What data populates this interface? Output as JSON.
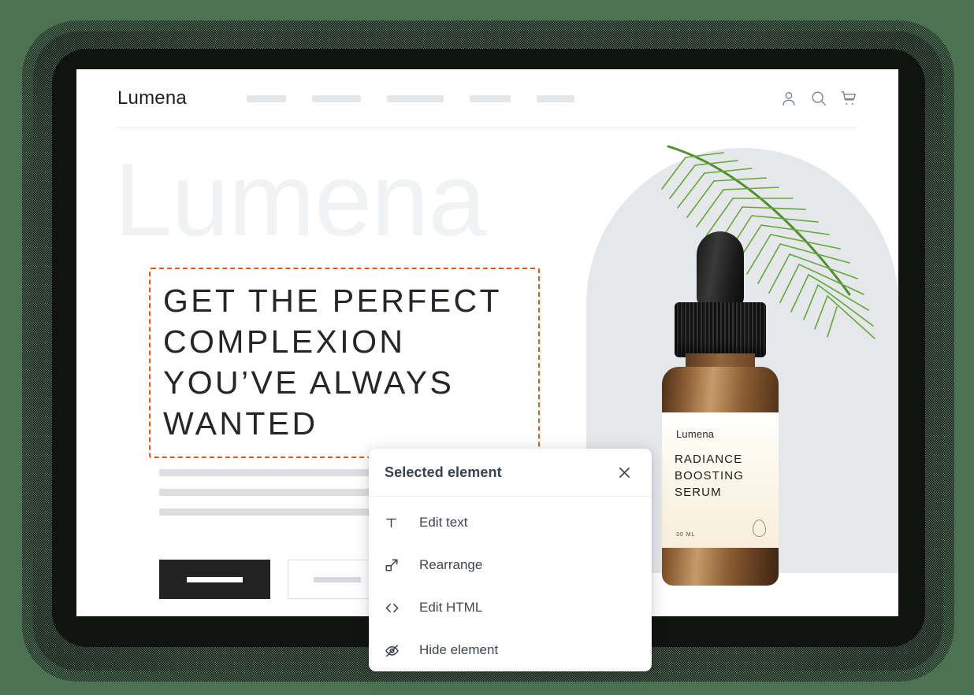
{
  "site": {
    "logo": "Lumena",
    "watermark": "Lumena",
    "nav_placeholder_widths": [
      50,
      62,
      72,
      52,
      48
    ],
    "header_icons": [
      {
        "name": "account-icon",
        "label": "Account"
      },
      {
        "name": "search-icon",
        "label": "Search"
      },
      {
        "name": "cart-icon",
        "label": "Cart"
      }
    ],
    "hero": {
      "headline": "GET THE PERFECT COMPLEXION YOU’VE ALWAYS WANTED",
      "body_line_widths": [
        333,
        377,
        268
      ],
      "buttons": {
        "primary_label": "",
        "secondary_label": ""
      }
    },
    "product": {
      "brand": "Lumena",
      "name_line_1": "RADIANCE",
      "name_line_2": "BOOSTING",
      "name_line_3": "SERUM",
      "size": "30 ML"
    }
  },
  "selection": {
    "border_color": "#e6551d",
    "target": "headline"
  },
  "popup": {
    "title": "Selected element",
    "close_label": "Close",
    "items": [
      {
        "icon": "text-icon",
        "label": "Edit text"
      },
      {
        "icon": "rearrange-icon",
        "label": "Rearrange"
      },
      {
        "icon": "code-icon",
        "label": "Edit HTML"
      },
      {
        "icon": "eye-off-icon",
        "label": "Hide element"
      }
    ]
  },
  "colors": {
    "background": "#4a7253",
    "panel": "#ffffff",
    "accent_orange": "#e6551d",
    "dark_button": "#222222",
    "text_dark": "#24262a",
    "placeholder_gray": "#dcdee2",
    "arch_gray": "#e5e7ea"
  }
}
